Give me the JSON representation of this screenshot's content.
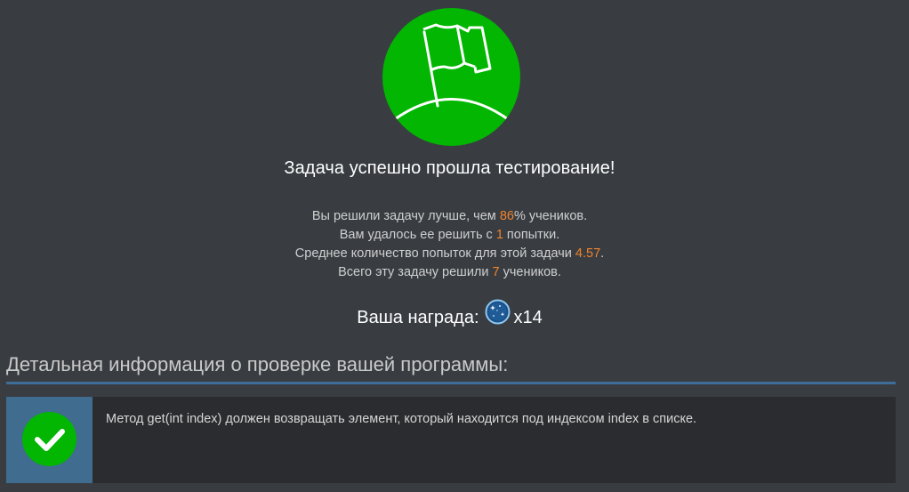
{
  "result": {
    "title": "Задача успешно прошла тестирование!"
  },
  "stats": {
    "line1_prefix": "Вы решили задачу лучше, чем ",
    "line1_value": "86",
    "line1_suffix": "% учеников.",
    "line2_prefix": "Вам удалось ее решить с ",
    "line2_value": "1",
    "line2_suffix": " попытки.",
    "line3_prefix": "Среднее количество попыток для этой задачи ",
    "line3_value": "4.57",
    "line3_suffix": ".",
    "line4_prefix": "Всего эту задачу решили ",
    "line4_value": "7",
    "line4_suffix": " учеников."
  },
  "reward": {
    "label": "Ваша награда:",
    "icon": "dark-matter-gem-icon",
    "count": "x14"
  },
  "details": {
    "title": "Детальная информация о проверке вашей программы:",
    "checks": [
      {
        "status_icon": "check-icon",
        "message": "Метод get(int index) должен возвращать элемент, который находится под индексом index в списке."
      }
    ]
  },
  "colors": {
    "background": "#393d42",
    "success_green": "#02b602",
    "highlight_orange": "#f0842a",
    "accent_blue": "#3e6d99"
  }
}
